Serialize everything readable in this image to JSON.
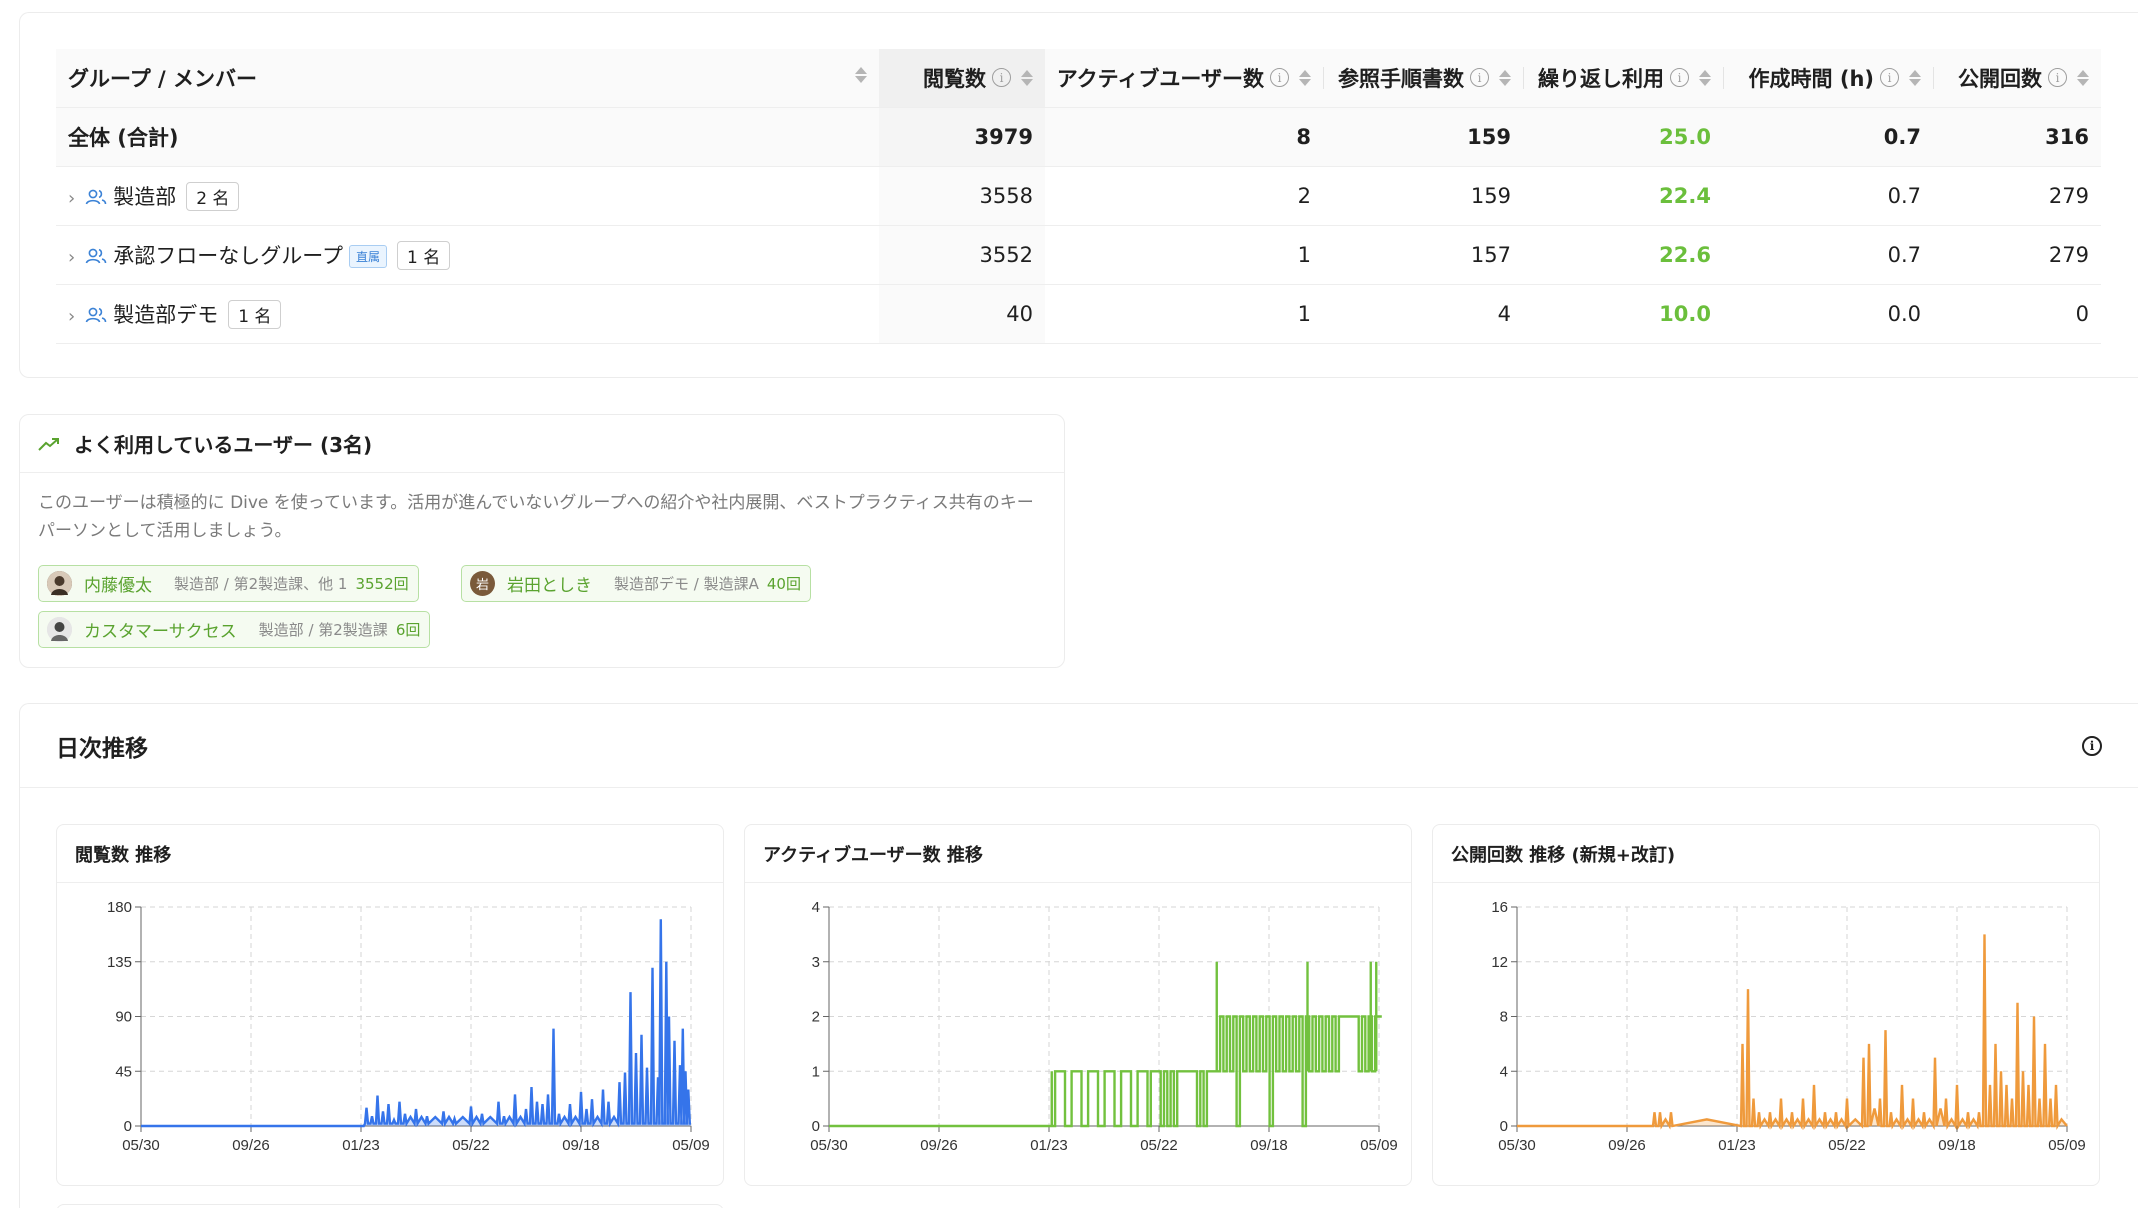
{
  "table": {
    "headers": {
      "group": "グループ / メンバー",
      "views": "閲覧数",
      "active_users": "アクティブユーザー数",
      "referenced_docs": "参照手順書数",
      "repeat_use": "繰り返し利用",
      "creation_time": "作成時間 (h)",
      "publish_count": "公開回数"
    },
    "total": {
      "label": "全体 (合計)",
      "views": "3979",
      "active_users": "8",
      "referenced_docs": "159",
      "repeat_use": "25.0",
      "creation_time": "0.7",
      "publish_count": "316"
    },
    "rows": [
      {
        "name": "製造部",
        "tag": "",
        "members": "2 名",
        "views": "3558",
        "active_users": "2",
        "referenced_docs": "159",
        "repeat_use": "22.4",
        "creation_time": "0.7",
        "publish_count": "279"
      },
      {
        "name": "承認フローなしグループ",
        "tag": "直属",
        "members": "1 名",
        "views": "3552",
        "active_users": "1",
        "referenced_docs": "157",
        "repeat_use": "22.6",
        "creation_time": "0.7",
        "publish_count": "279"
      },
      {
        "name": "製造部デモ",
        "tag": "",
        "members": "1 名",
        "views": "40",
        "active_users": "1",
        "referenced_docs": "4",
        "repeat_use": "10.0",
        "creation_time": "0.0",
        "publish_count": "0"
      }
    ]
  },
  "heavy_users": {
    "title": "よく利用しているユーザー (3名)",
    "description": "このユーザーは積極的に Dive を使っています。活用が進んでいないグループへの紹介や社内展開、ベストプラクティス共有のキーパーソンとして活用しましょう。",
    "users": [
      {
        "name": "内藤優太",
        "dept": "製造部 / 第2製造課、他 1",
        "count": "3552回",
        "avatar": "photo"
      },
      {
        "name": "岩田としき",
        "dept": "製造部デモ / 製造課A",
        "count": "40回",
        "avatar_letter": "岩"
      },
      {
        "name": "カスタマーサクセス",
        "dept": "製造部 / 第2製造課",
        "count": "6回",
        "avatar": "photo"
      }
    ]
  },
  "daily": {
    "title": "日次推移",
    "x_ticks": [
      "05/30",
      "09/26",
      "01/23",
      "05/22",
      "09/18",
      "05/09"
    ]
  },
  "colors": {
    "views": "#3574ea",
    "active": "#72c13e",
    "publish": "#ef9a3c",
    "green_text": "#6bbf3c"
  },
  "chart_data": [
    {
      "type": "area",
      "title": "閲覧数 推移",
      "color": "#3574ea",
      "ylim": [
        0,
        180
      ],
      "y_ticks": [
        0,
        45,
        90,
        135,
        180
      ],
      "x_ticks": [
        "05/30",
        "09/26",
        "01/23",
        "05/22",
        "09/18",
        "05/09"
      ],
      "grid": true,
      "spikes": [
        [
          0.41,
          15
        ],
        [
          0.42,
          8
        ],
        [
          0.43,
          25
        ],
        [
          0.44,
          12
        ],
        [
          0.45,
          18
        ],
        [
          0.46,
          5
        ],
        [
          0.47,
          20
        ],
        [
          0.48,
          10
        ],
        [
          0.5,
          14
        ],
        [
          0.52,
          8
        ],
        [
          0.55,
          12
        ],
        [
          0.57,
          6
        ],
        [
          0.6,
          16
        ],
        [
          0.62,
          10
        ],
        [
          0.65,
          20
        ],
        [
          0.66,
          8
        ],
        [
          0.68,
          26
        ],
        [
          0.7,
          14
        ],
        [
          0.71,
          32
        ],
        [
          0.72,
          20
        ],
        [
          0.73,
          18
        ],
        [
          0.74,
          26
        ],
        [
          0.75,
          80
        ],
        [
          0.76,
          10
        ],
        [
          0.78,
          18
        ],
        [
          0.8,
          28
        ],
        [
          0.81,
          14
        ],
        [
          0.82,
          22
        ],
        [
          0.84,
          30
        ],
        [
          0.85,
          20
        ],
        [
          0.87,
          36
        ],
        [
          0.88,
          44
        ],
        [
          0.89,
          110
        ],
        [
          0.9,
          60
        ],
        [
          0.91,
          75
        ],
        [
          0.92,
          48
        ],
        [
          0.93,
          130
        ],
        [
          0.94,
          40
        ],
        [
          0.945,
          170
        ],
        [
          0.955,
          135
        ],
        [
          0.96,
          90
        ],
        [
          0.97,
          70
        ],
        [
          0.98,
          50
        ],
        [
          0.985,
          80
        ],
        [
          0.99,
          45
        ],
        [
          0.995,
          30
        ]
      ],
      "baseline": 2
    },
    {
      "type": "line",
      "title": "アクティブユーザー数 推移",
      "color": "#72c13e",
      "ylim": [
        0,
        4
      ],
      "y_ticks": [
        0,
        1,
        2,
        3,
        4
      ],
      "x_ticks": [
        "05/30",
        "09/26",
        "01/23",
        "05/22",
        "09/18",
        "05/09"
      ],
      "grid": true
    },
    {
      "type": "area",
      "title": "公開回数 推移 (新規+改訂)",
      "color": "#ef9a3c",
      "ylim": [
        0,
        16
      ],
      "y_ticks": [
        0,
        4,
        8,
        12,
        16
      ],
      "x_ticks": [
        "05/30",
        "09/26",
        "01/23",
        "05/22",
        "09/18",
        "05/09"
      ],
      "grid": true,
      "spikes": [
        [
          0.25,
          1
        ],
        [
          0.26,
          1
        ],
        [
          0.28,
          1
        ],
        [
          0.41,
          6
        ],
        [
          0.42,
          10
        ],
        [
          0.43,
          2
        ],
        [
          0.44,
          1
        ],
        [
          0.46,
          1
        ],
        [
          0.48,
          2
        ],
        [
          0.5,
          1
        ],
        [
          0.52,
          2
        ],
        [
          0.54,
          3
        ],
        [
          0.56,
          1
        ],
        [
          0.58,
          1
        ],
        [
          0.6,
          2
        ],
        [
          0.63,
          5
        ],
        [
          0.64,
          6
        ],
        [
          0.66,
          2
        ],
        [
          0.67,
          7
        ],
        [
          0.68,
          1
        ],
        [
          0.7,
          3
        ],
        [
          0.72,
          2
        ],
        [
          0.74,
          1
        ],
        [
          0.76,
          5
        ],
        [
          0.78,
          2
        ],
        [
          0.8,
          3
        ],
        [
          0.82,
          1
        ],
        [
          0.84,
          1
        ],
        [
          0.85,
          14
        ],
        [
          0.86,
          3
        ],
        [
          0.87,
          6
        ],
        [
          0.88,
          4
        ],
        [
          0.89,
          3
        ],
        [
          0.9,
          2
        ],
        [
          0.91,
          9
        ],
        [
          0.92,
          4
        ],
        [
          0.93,
          3
        ],
        [
          0.94,
          8
        ],
        [
          0.95,
          2
        ],
        [
          0.96,
          6
        ],
        [
          0.97,
          2
        ],
        [
          0.98,
          3
        ]
      ],
      "baseline": 0
    }
  ]
}
